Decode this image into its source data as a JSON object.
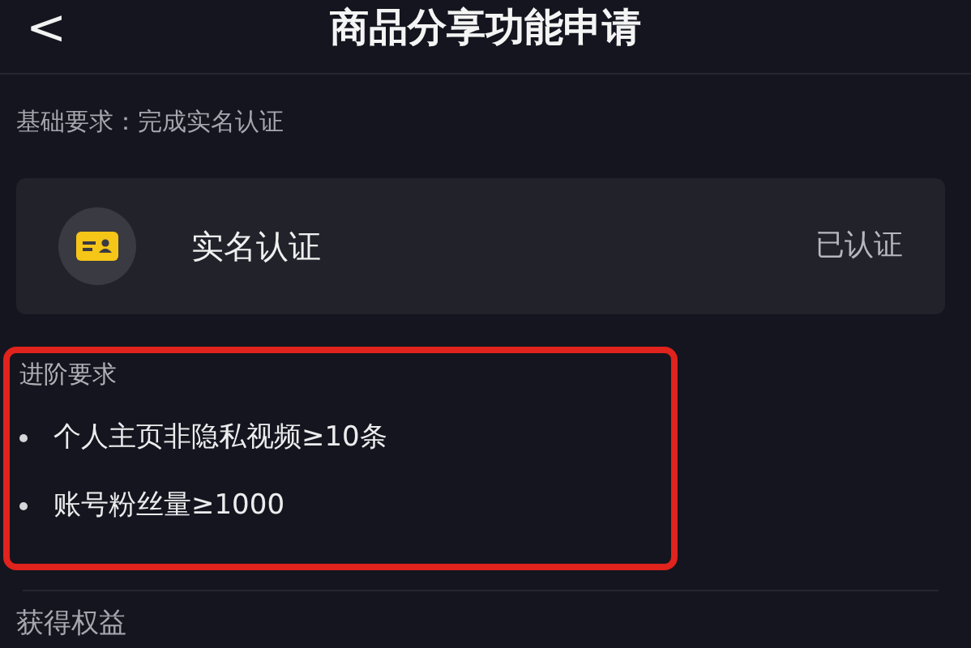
{
  "header": {
    "back_glyph": "<",
    "title": "商品分享功能申请"
  },
  "basic_requirement": "基础要求：完成实名认证",
  "verification": {
    "label": "实名认证",
    "status": "已认证"
  },
  "advanced": {
    "title": "进阶要求",
    "items": [
      "个人主页非隐私视频≥10条",
      "账号粉丝量≥1000"
    ]
  },
  "benefits_title": "获得权益"
}
